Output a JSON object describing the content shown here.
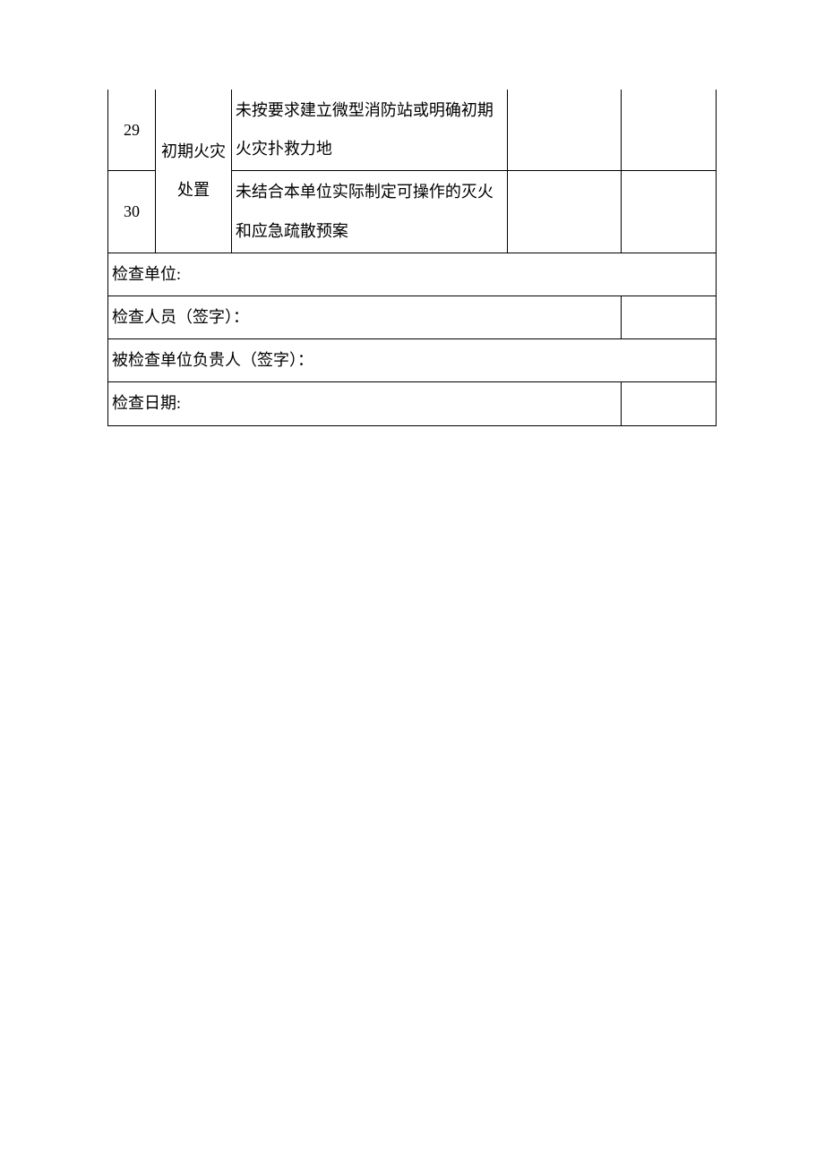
{
  "rows": [
    {
      "num": "29",
      "desc": "未按要求建立微型消防站或明确初期火灾扑救力地"
    },
    {
      "num": "30",
      "desc": "未结合本单位实际制定可操作的灭火和应急疏散预案"
    }
  ],
  "category": "初期火灾处置",
  "footer": {
    "unit": "检查单位:",
    "inspector": "检查人员（签字）：",
    "inspected_responsible": "被检查单位负贵人（签字）：",
    "date": "检查日期:"
  }
}
